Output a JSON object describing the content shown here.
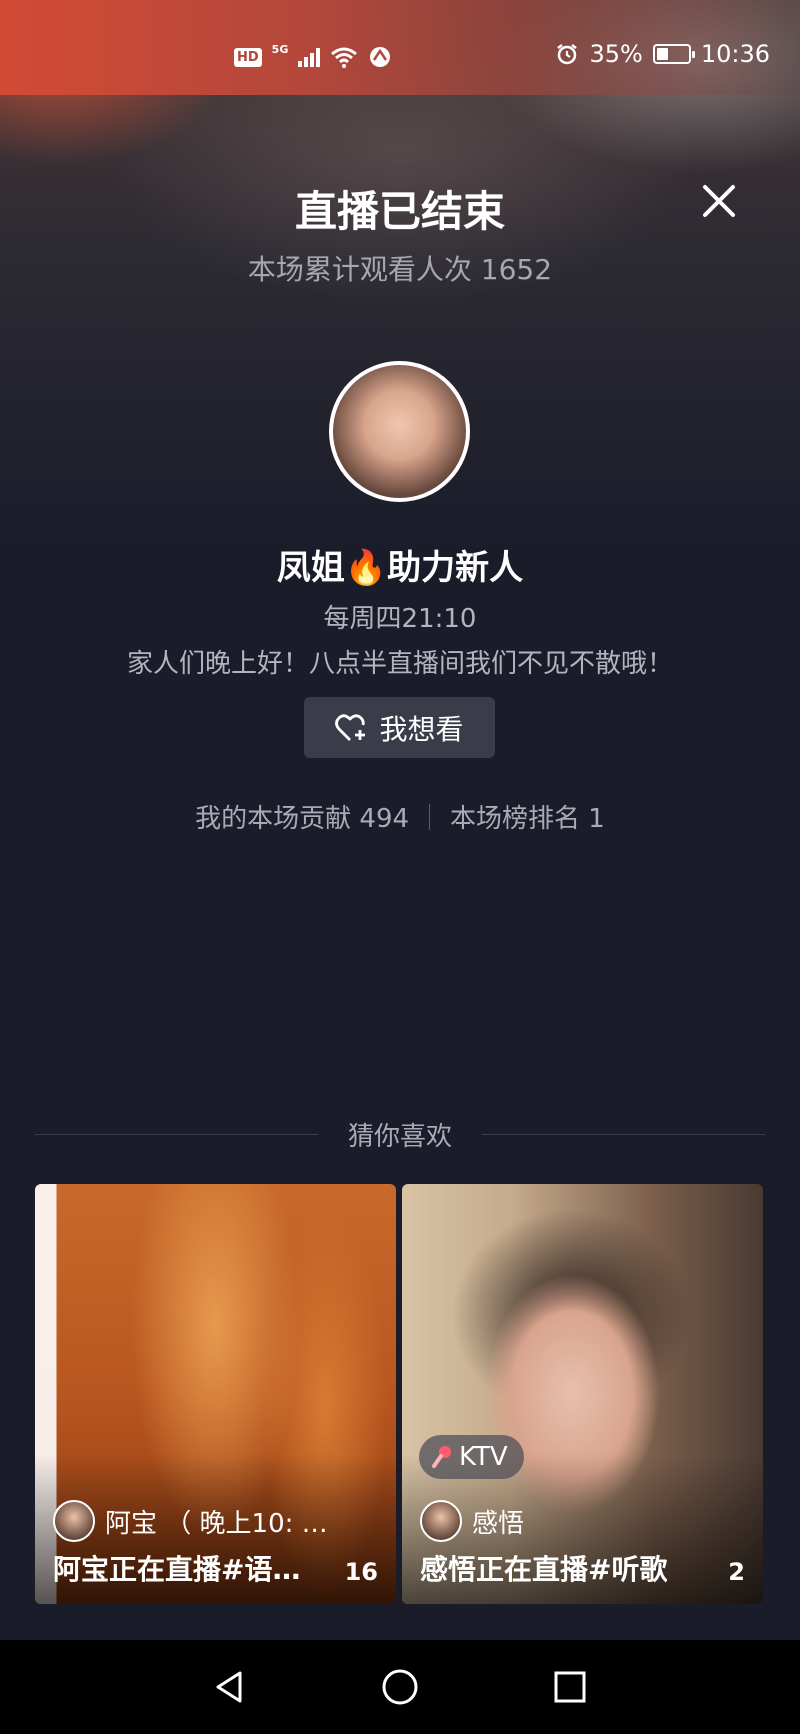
{
  "status_bar": {
    "hd": "HD",
    "network": "5G",
    "battery_text": "35%",
    "battery_level": 0.35,
    "time": "10:36"
  },
  "header": {
    "title": "直播已结束",
    "viewers_text": "本场累计观看人次 1652",
    "close_icon": "close-icon"
  },
  "host": {
    "name": "凤姐🔥助力新人",
    "schedule": "每周四21:10",
    "announcement": "家人们晚上好！八点半直播间我们不见不散哦！",
    "follow_label": "我想看"
  },
  "stats": {
    "contribution": "我的本场贡献 494",
    "rank": "本场榜排名 1"
  },
  "recommend": {
    "title": "猜你喜欢",
    "cards": [
      {
        "host": "阿宝 （ 晚上10: …",
        "title": "阿宝正在直播#语…",
        "count": "16",
        "badge": ""
      },
      {
        "host": "感悟",
        "title": "感悟正在直播#听歌",
        "count": "2",
        "badge": "KTV"
      }
    ]
  },
  "colors": {
    "background": "#1a1c2a",
    "status_bar_accent": "#d24b35",
    "button_bg": "#3a3c49"
  }
}
